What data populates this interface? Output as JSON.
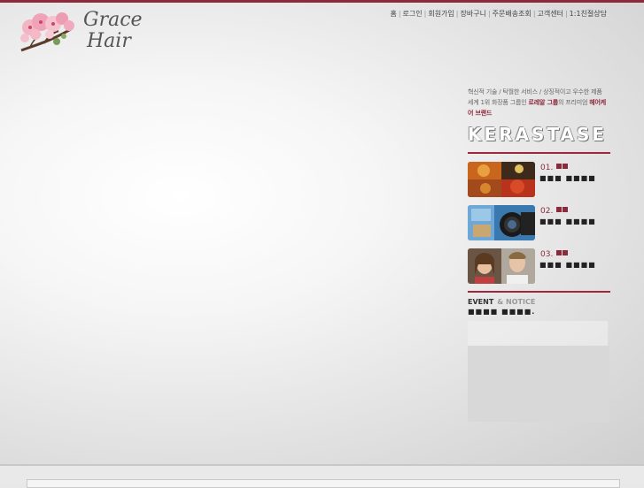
{
  "logo": {
    "line1": "Grace",
    "line2": "Hair"
  },
  "nav": [
    "홈",
    "로그인",
    "회원가입",
    "장바구니",
    "주문배송조회",
    "고객센터",
    "1:1친절상담"
  ],
  "promo": {
    "tagline_line1": "혁신적 기술 / 탁월한 서비스 / 상징적이고 우수한 제품",
    "tagline_line2_pre": "세계 1위 화장품 그룹인 ",
    "tagline_line2_group": "로레알 그룹",
    "tagline_line2_mid": "의 프리미엄 ",
    "tagline_line2_brand": "헤어케어 브랜드",
    "brand": "KERASTASE"
  },
  "features": [
    {
      "num": "01.",
      "title": "■■■ ■■■■"
    },
    {
      "num": "02.",
      "title": "■■■ ■■■■"
    },
    {
      "num": "03.",
      "title": "■■■ ■■■■"
    }
  ],
  "event": {
    "label": "EVENT",
    "notice": "& NOTICE",
    "text": "■■■■ ■■■■."
  }
}
